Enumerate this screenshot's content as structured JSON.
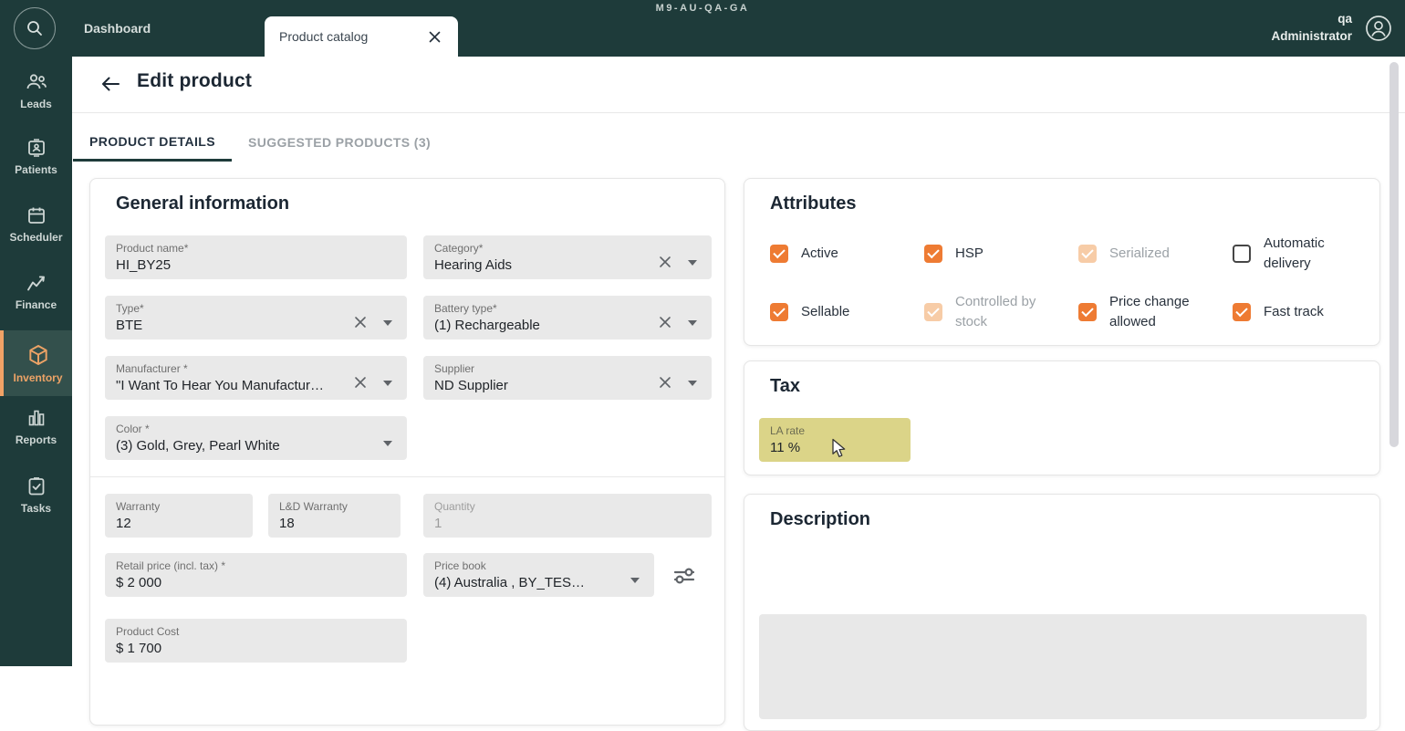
{
  "topbar": {
    "environment": "M9-AU-QA-GA",
    "nav_dashboard": "Dashboard",
    "tab_label": "Product catalog",
    "user": {
      "line1": "qa",
      "line2": "Administrator"
    }
  },
  "sidebar": {
    "items": [
      {
        "label": "Leads",
        "icon": "people-icon",
        "active": false
      },
      {
        "label": "Patients",
        "icon": "patient-card-icon",
        "active": false
      },
      {
        "label": "Scheduler",
        "icon": "calendar-icon",
        "active": false
      },
      {
        "label": "Finance",
        "icon": "trending-chart-icon",
        "active": false
      },
      {
        "label": "Inventory",
        "icon": "cube-icon",
        "active": true
      },
      {
        "label": "Reports",
        "icon": "bar-chart-icon",
        "active": false
      },
      {
        "label": "Tasks",
        "icon": "task-check-icon",
        "active": false
      }
    ]
  },
  "header": {
    "title": "Edit product"
  },
  "view_tabs": {
    "product_details": "PRODUCT DETAILS",
    "suggested_products": "SUGGESTED PRODUCTS (3)"
  },
  "general": {
    "title": "General information",
    "product_name": {
      "label": "Product name*",
      "value": "HI_BY25"
    },
    "category": {
      "label": "Category*",
      "value": "Hearing Aids"
    },
    "type": {
      "label": "Type*",
      "value": "BTE"
    },
    "battery_type": {
      "label": "Battery type*",
      "value": "(1) Rechargeable"
    },
    "manufacturer": {
      "label": "Manufacturer *",
      "value": "\"I Want To Hear You Manufactur…"
    },
    "supplier": {
      "label": "Supplier",
      "value": "ND Supplier"
    },
    "color": {
      "label": "Color *",
      "value": "(3) Gold, Grey, Pearl White"
    },
    "warranty": {
      "label": "Warranty",
      "value": "12"
    },
    "ld_warranty": {
      "label": "L&D Warranty",
      "value": "18"
    },
    "quantity": {
      "label": "Quantity",
      "value": "1"
    },
    "retail_price": {
      "label": "Retail price (incl. tax) *",
      "value": "$ 2 000"
    },
    "price_book": {
      "label": "Price book",
      "value": "(4) Australia , BY_TES…"
    },
    "product_cost": {
      "label": "Product Cost",
      "value": "$ 1 700"
    }
  },
  "attributes": {
    "title": "Attributes",
    "items": [
      {
        "label": "Active",
        "checked": true,
        "disabled": false
      },
      {
        "label": "HSP",
        "checked": true,
        "disabled": false
      },
      {
        "label": "Serialized",
        "checked": true,
        "disabled": true
      },
      {
        "label": "Automatic delivery",
        "checked": false,
        "disabled": false
      },
      {
        "label": "Sellable",
        "checked": true,
        "disabled": false
      },
      {
        "label": "Controlled by stock",
        "checked": true,
        "disabled": true
      },
      {
        "label": "Price change allowed",
        "checked": true,
        "disabled": false
      },
      {
        "label": "Fast track",
        "checked": true,
        "disabled": false
      }
    ]
  },
  "tax": {
    "title": "Tax",
    "la_rate": {
      "label": "LA rate",
      "value": "11 %"
    }
  },
  "description": {
    "title": "Description"
  },
  "colors": {
    "topbar_teal": "#1E3B3A",
    "accent_orange": "#EE7B33",
    "disabled_orange": "#F7CCA7",
    "sidebar_active_text": "#EDA366",
    "field_gray": "#E9E9E9",
    "tax_highlight_yellow": "#DBD488"
  }
}
